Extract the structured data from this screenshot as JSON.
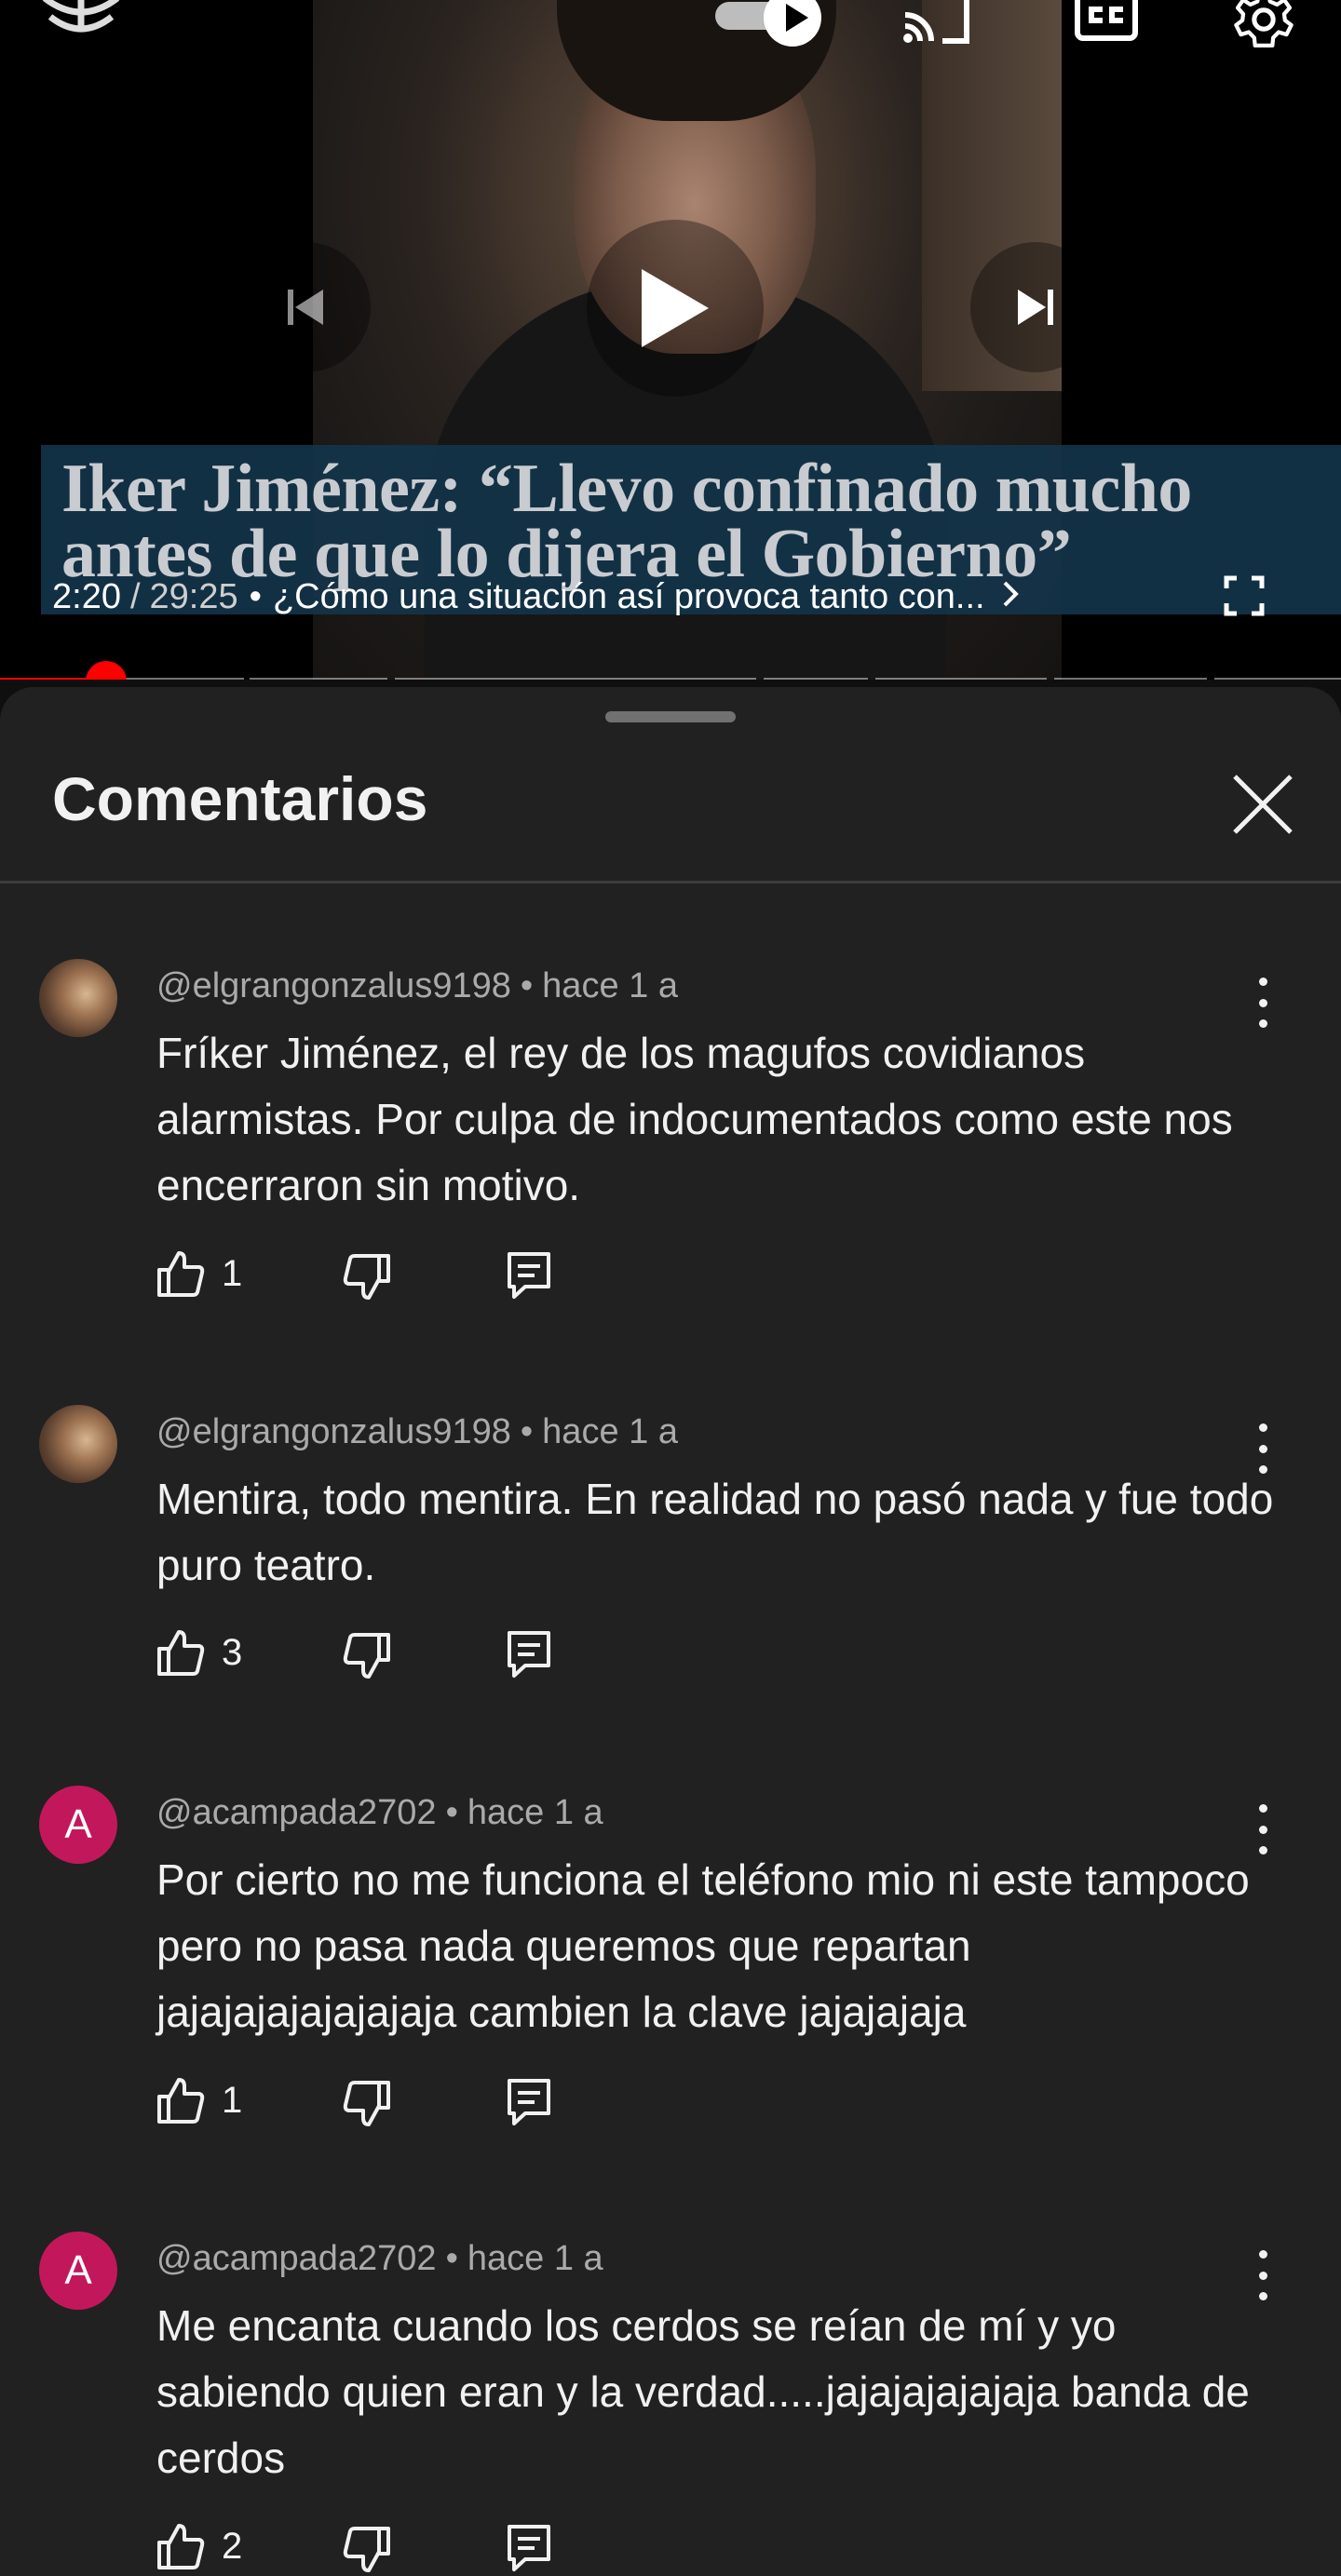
{
  "player": {
    "caption_line1": "Iker Jiménez: “Llevo confinado mucho",
    "caption_line2": "antes de que lo dijera el Gobierno”",
    "time_current": "2:20",
    "time_separator": "/",
    "time_total": "29:25",
    "chapter_separator": "•",
    "chapter_title": "¿Cómo una situación así provoca tanto con...",
    "progress_fraction": 0.0793,
    "autoplay_on": true,
    "icons": [
      "chevron-down-icon",
      "autoplay-toggle-icon",
      "cast-icon",
      "closed-captions-icon",
      "settings-gear-icon",
      "previous-icon",
      "play-icon",
      "next-icon",
      "fullscreen-icon"
    ],
    "colors": {
      "progress": "#ff0000",
      "caption_bg": "#14344a",
      "caption_text": "#c8cbd0"
    }
  },
  "comments_panel": {
    "title": "Comentarios",
    "close_icon": "close-icon",
    "comments": [
      {
        "author": "@elgrangonzalus9198",
        "separator": "•",
        "time": "hace 1 a",
        "text": "Fríker Jiménez, el rey de los magufos covidianos alarmistas. Por culpa de indocumentados como este nos encerraron sin motivo.",
        "likes": "1",
        "avatar_letter": ""
      },
      {
        "author": "@elgrangonzalus9198",
        "separator": "•",
        "time": "hace 1 a",
        "text": "Mentira, todo mentira. En realidad no pasó nada y fue todo puro teatro.",
        "likes": "3",
        "avatar_letter": ""
      },
      {
        "author": "@acampada2702",
        "separator": "•",
        "time": "hace 1 a",
        "text": "Por cierto no me funciona el teléfono mio ni este tampoco pero no pasa nada queremos que repartan jajajajajajajajaja cambien la clave jajajajaja",
        "likes": "1",
        "avatar_letter": "A"
      },
      {
        "author": "@acampada2702",
        "separator": "•",
        "time": "hace 1 a",
        "text": "Me encanta cuando los cerdos se reían de mí y yo sabiendo quien eran y la verdad.....jajajajajajaja banda de cerdos",
        "likes": "2",
        "avatar_letter": "A"
      }
    ],
    "colors": {
      "avatar_letter_bg": "#c2185b",
      "panel_bg": "#212121",
      "meta_text": "#aaaaaa"
    }
  }
}
